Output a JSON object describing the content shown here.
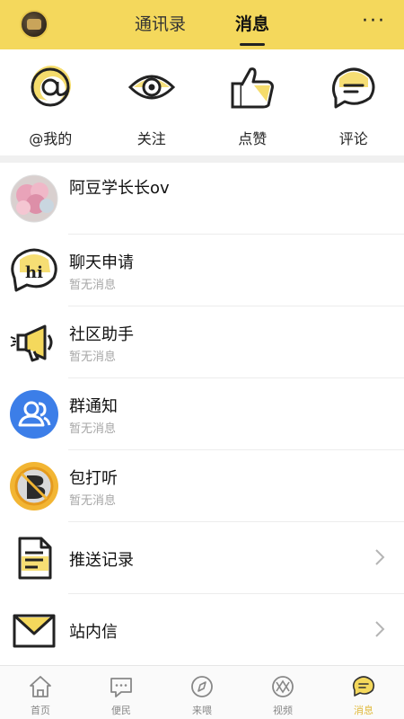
{
  "header": {
    "tabs": [
      {
        "label": "通讯录",
        "active": false
      },
      {
        "label": "消息",
        "active": true
      }
    ],
    "more_label": "···",
    "accent_color": "#f4d85c"
  },
  "quick_actions": [
    {
      "label": "@我的",
      "icon": "at-icon"
    },
    {
      "label": "关注",
      "icon": "eye-icon"
    },
    {
      "label": "点赞",
      "icon": "thumbs-up-icon"
    },
    {
      "label": "评论",
      "icon": "comment-icon"
    }
  ],
  "messages": [
    {
      "title": "阿豆学长长ov",
      "subtitle": "",
      "icon": "user-avatar"
    },
    {
      "title": "聊天申请",
      "subtitle": "暂无消息",
      "icon": "hi-chat-icon"
    },
    {
      "title": "社区助手",
      "subtitle": "暂无消息",
      "icon": "megaphone-icon"
    },
    {
      "title": "群通知",
      "subtitle": "暂无消息",
      "icon": "group-icon"
    },
    {
      "title": "包打听",
      "subtitle": "暂无消息",
      "icon": "baodating-icon"
    },
    {
      "title": "推送记录",
      "subtitle": "",
      "icon": "document-icon",
      "chevron": true
    },
    {
      "title": "站内信",
      "subtitle": "",
      "icon": "envelope-icon",
      "chevron": true
    }
  ],
  "bottom_nav": [
    {
      "label": "首页",
      "icon": "home-icon",
      "active": false
    },
    {
      "label": "便民",
      "icon": "service-icon",
      "active": false
    },
    {
      "label": "来喂",
      "icon": "compass-icon",
      "active": false
    },
    {
      "label": "视频",
      "icon": "video-icon",
      "active": false
    },
    {
      "label": "消息",
      "icon": "message-icon",
      "active": true
    }
  ]
}
